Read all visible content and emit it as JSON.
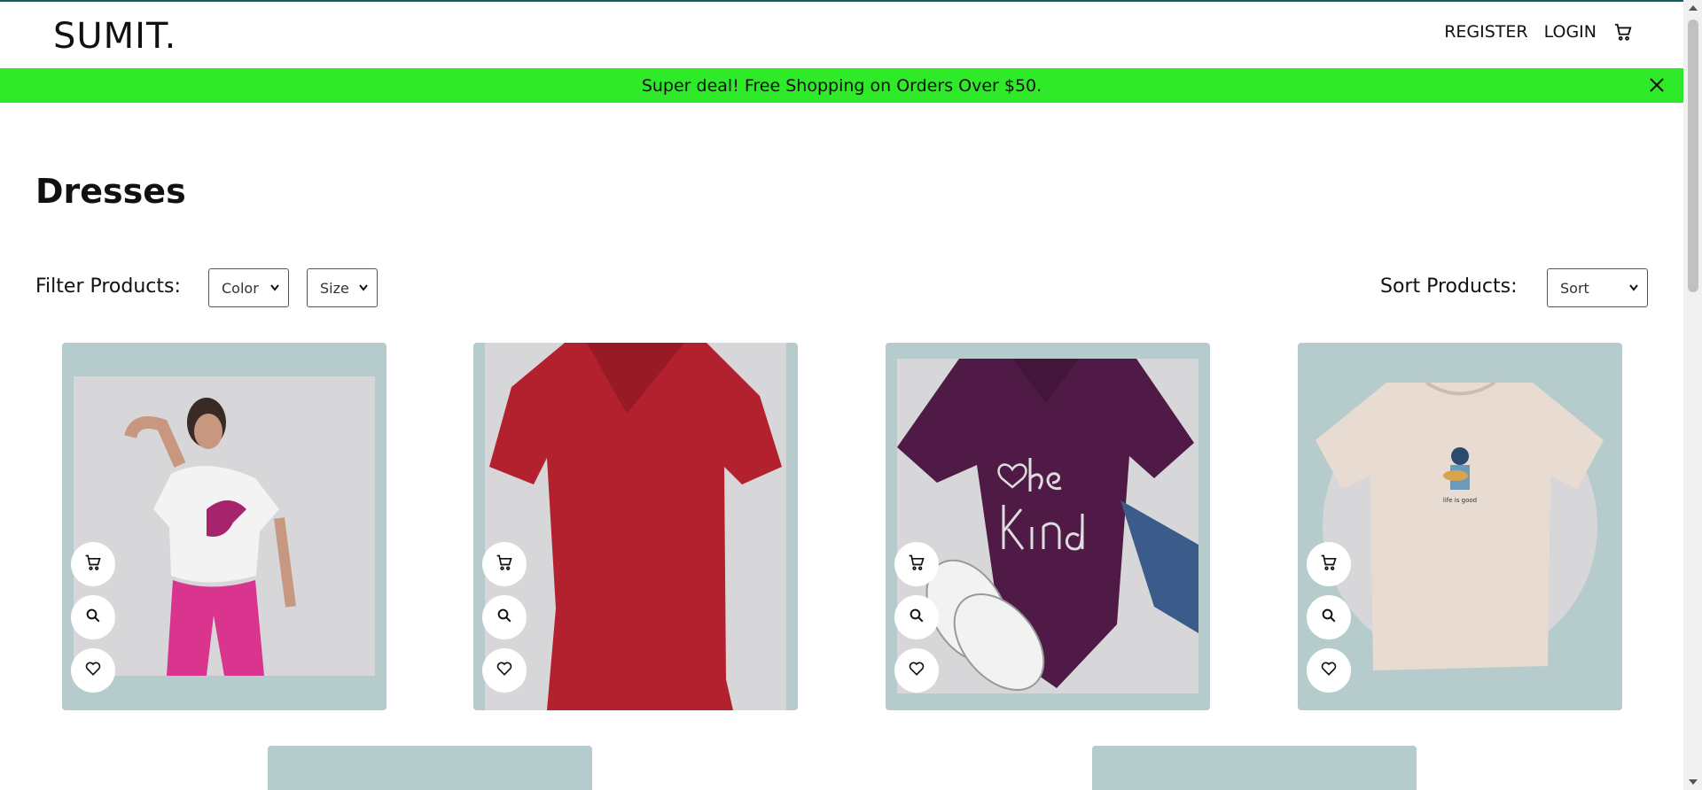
{
  "header": {
    "logo": "SUMIT.",
    "nav": {
      "register": "REGISTER",
      "login": "LOGIN"
    },
    "cart_icon": "cart-icon"
  },
  "announcement": {
    "text": "Super deal! Free Shopping on Orders Over $50.",
    "close_icon": "close-icon",
    "background": "#2fea28"
  },
  "page": {
    "title": "Dresses"
  },
  "filters": {
    "label": "Filter Products:",
    "color_select": "Color",
    "size_select": "Size"
  },
  "sort": {
    "label": "Sort Products:",
    "select": "Sort"
  },
  "products": [
    {
      "image": "woman in white puma t-shirt and pink leggings",
      "actions": [
        "cart-icon",
        "search-icon",
        "heart-icon"
      ]
    },
    {
      "image": "red v-neck t-shirt",
      "actions": [
        "cart-icon",
        "search-icon",
        "heart-icon"
      ]
    },
    {
      "image": "purple be kind v-neck t-shirt with sneakers and jeans",
      "actions": [
        "cart-icon",
        "search-icon",
        "heart-icon"
      ]
    },
    {
      "image": "beige life is good graphic t-shirt",
      "actions": [
        "cart-icon",
        "search-icon",
        "heart-icon"
      ]
    }
  ],
  "colors": {
    "card_bg": "#b6cccc",
    "accent_line": "#0f5f5f"
  }
}
